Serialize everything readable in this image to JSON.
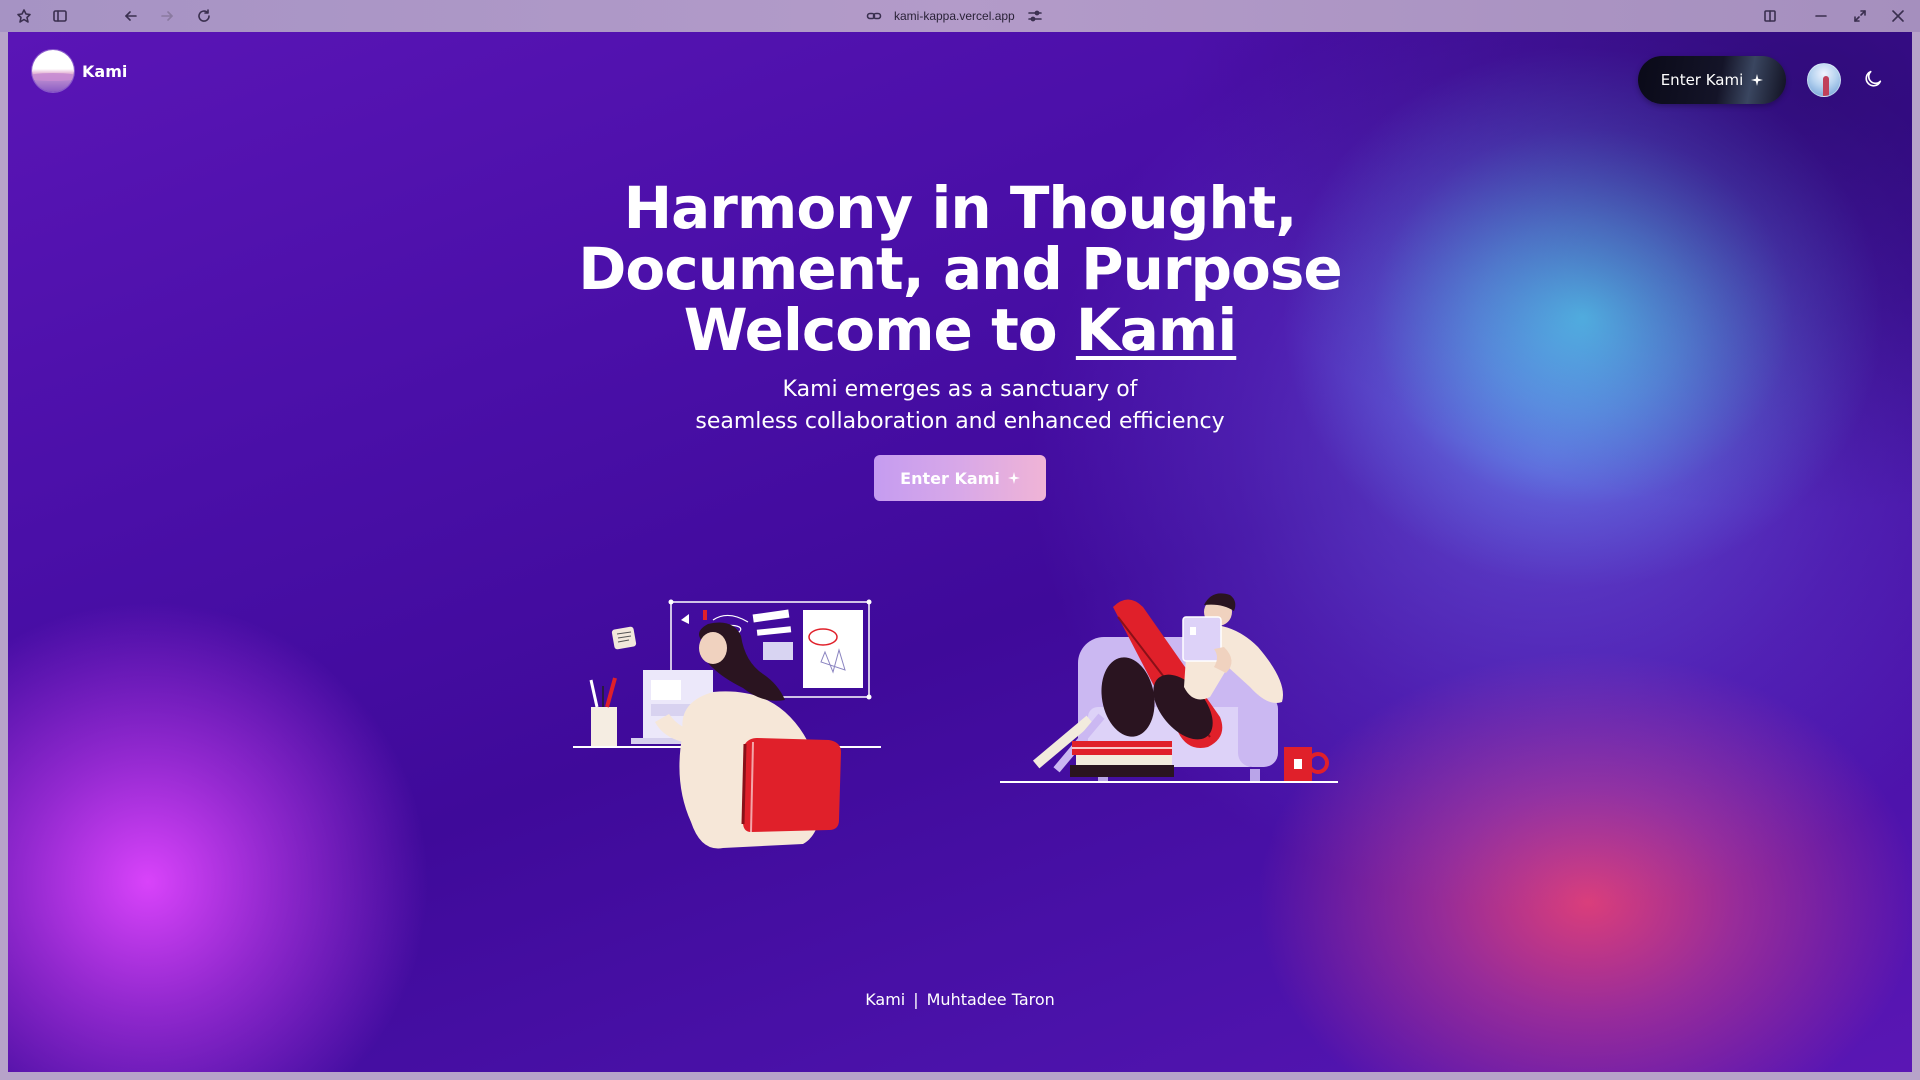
{
  "browser": {
    "url": "kami-kappa.vercel.app",
    "icons": [
      "extensions-icon",
      "sidebar-icon",
      "back-icon",
      "forward-icon",
      "reload-icon",
      "link-icon",
      "tune-icon",
      "split-view-icon",
      "minimize-icon",
      "restore-icon",
      "close-icon"
    ]
  },
  "header": {
    "logo_text": "Kami",
    "enter_button_label": "Enter Kami",
    "theme_icon": "moon-icon"
  },
  "hero": {
    "title_line1": "Harmony in Thought,",
    "title_line2": "Document, and Purpose",
    "title_line3_prefix": "Welcome to ",
    "title_line3_brand": "Kami",
    "subtitle_line1": "Kami emerges as a sanctuary of",
    "subtitle_line2": "seamless collaboration and enhanced efficiency",
    "cta_label": "Enter Kami"
  },
  "footer": {
    "brand": "Kami",
    "separator": "|",
    "author": "Muhtadee Taron"
  },
  "colors": {
    "background": "#4a0fa8",
    "glow_cyan": "#5cd6ff",
    "glow_magenta": "#e146ff",
    "glow_pink": "#e24078",
    "cta_start": "#c59cf0",
    "cta_end": "#f0b4d6",
    "illustration_red": "#e0202a"
  }
}
